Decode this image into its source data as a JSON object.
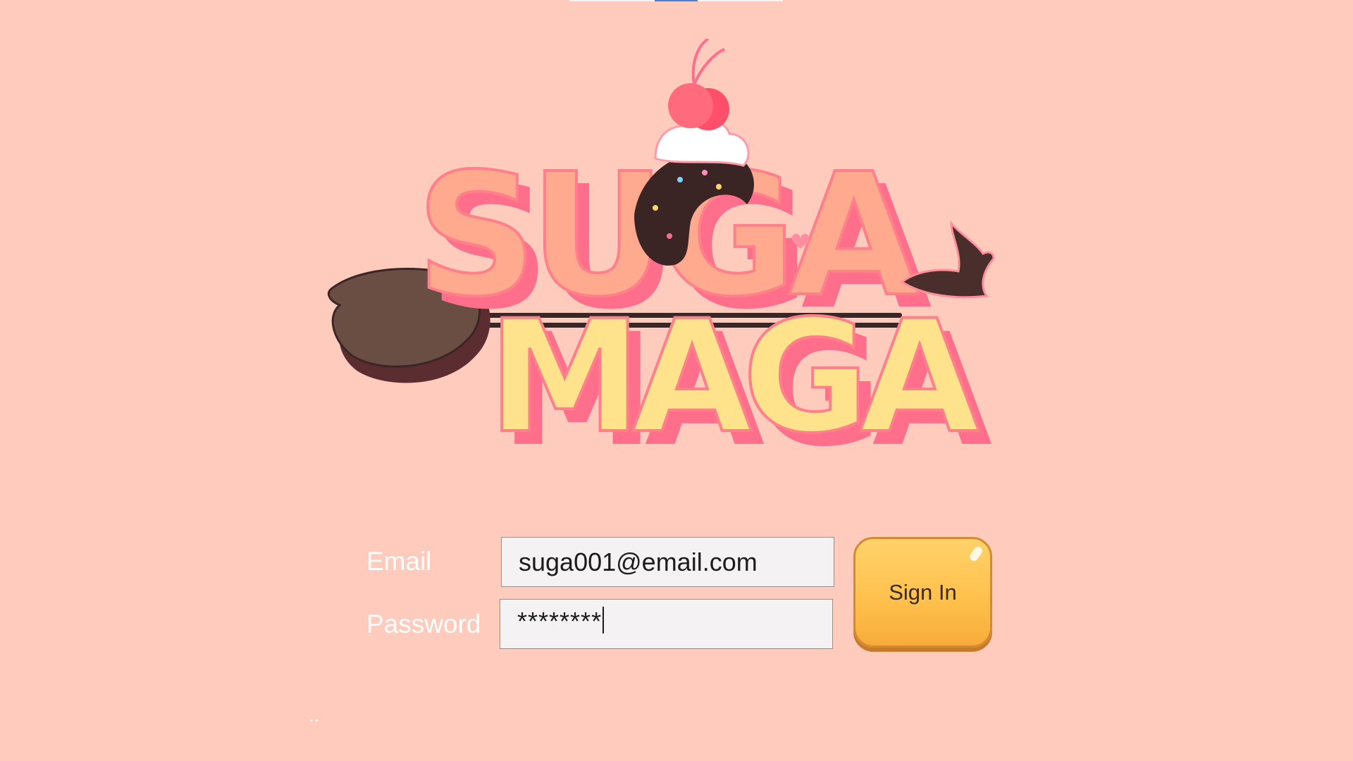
{
  "app": {
    "logo_text": [
      "SUGA",
      "MAGA"
    ]
  },
  "form": {
    "email_label": "Email",
    "email_value": "suga001@email.com",
    "password_label": "Password",
    "password_value": "********"
  },
  "actions": {
    "sign_in_label": "Sign In"
  },
  "footer": {
    "dots": ".."
  },
  "colors": {
    "background": "#fecbbd",
    "button_fill": "#ffc14d",
    "logo_suga": "#ffa98f",
    "logo_maga": "#ffe38c",
    "logo_shadow": "#ff6f8c"
  },
  "icons": [
    "cherry-icon",
    "broom-icon",
    "witch-hat-icon"
  ]
}
